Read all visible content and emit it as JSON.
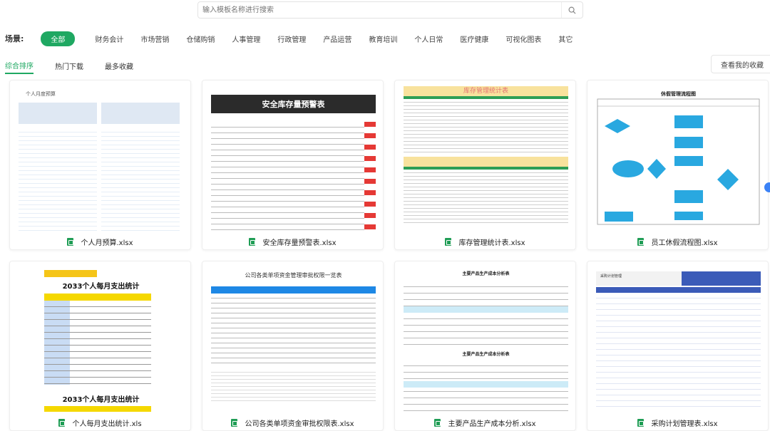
{
  "search": {
    "placeholder": "输入模板名称进行搜索"
  },
  "scene": {
    "label": "场景:",
    "chips": [
      "全部",
      "财务会计",
      "市场营销",
      "仓储购销",
      "人事管理",
      "行政管理",
      "产品运营",
      "教育培训",
      "个人日常",
      "医疗健康",
      "可视化图表",
      "其它"
    ]
  },
  "sort": {
    "tabs": [
      "综合排序",
      "热门下载",
      "最多收藏"
    ]
  },
  "my_fav": "查看我的收藏",
  "colors": {
    "accent": "#1fa862",
    "excel": "#1f9d55"
  },
  "cards": [
    {
      "title": "个人月预算.xlsx",
      "thumb_title": "个人月度预算"
    },
    {
      "title": "安全库存量预警表.xlsx",
      "thumb_title": "安全库存量预警表"
    },
    {
      "title": "库存管理统计表.xlsx",
      "thumb_title": "库存管理统计表"
    },
    {
      "title": "员工休假流程图.xlsx",
      "thumb_title": "休假管理流程图"
    },
    {
      "title": "个人每月支出统计.xls",
      "thumb_title": "2033个人每月支出统计"
    },
    {
      "title": "公司各类单项资金审批权限表.xlsx",
      "thumb_title": "公司各类单项资金管理审批权限一览表"
    },
    {
      "title": "主要产品生产成本分析.xlsx",
      "thumb_title": "主要产品生产成本分析表"
    },
    {
      "title": "采购计划管理表.xlsx",
      "thumb_title": "采购计划管理"
    }
  ]
}
